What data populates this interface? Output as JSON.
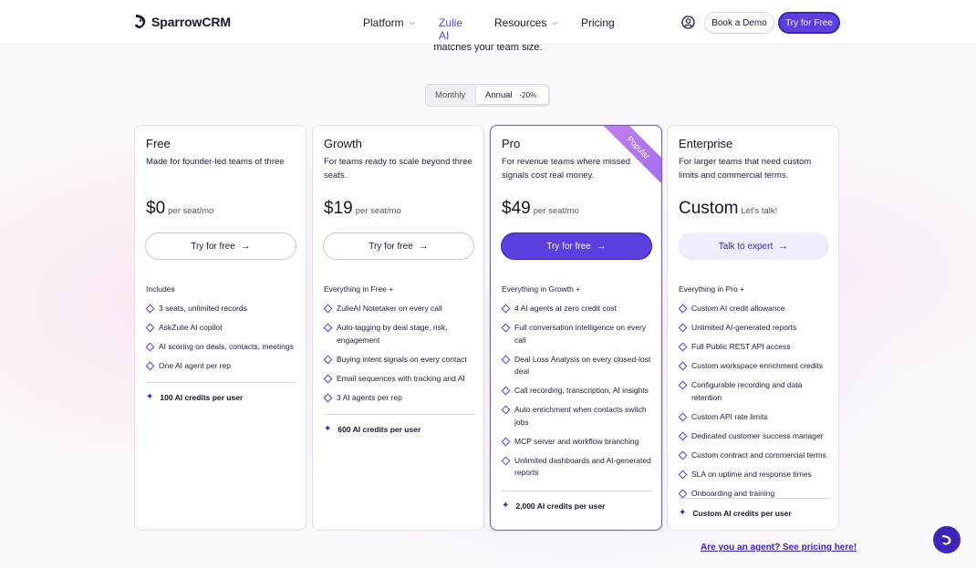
{
  "nav": {
    "logo": "SparrowCRM",
    "links": [
      "Platform",
      "Zulie AI",
      "Resources",
      "Pricing"
    ],
    "book_demo": "Book a Demo",
    "try_free": "Try for Free"
  },
  "hero": {
    "subtitle": "matches your team size."
  },
  "toggle": {
    "monthly": "Monthly",
    "annual": "Annual",
    "badge": "-20%"
  },
  "plans": [
    {
      "name": "Free",
      "desc": "Made for founder-led teams of three",
      "price": "$0",
      "unit": "per seat/mo",
      "cta": "Try for free",
      "includes": "Includes",
      "features": [
        "3 seats, unlimited records",
        "AskZulie AI copilot",
        "AI scoring on deals, contacts, meetings",
        "One AI agent per rep"
      ],
      "credits": "100 AI credits per user"
    },
    {
      "name": "Growth",
      "desc": "For teams ready to scale beyond three seats.",
      "price": "$19",
      "unit": "per seat/mo",
      "cta": "Try for free",
      "includes": "Everything in Free +",
      "features": [
        "ZulieAI Notetaker on every call",
        "Auto-tagging by deal stage, risk, engagement",
        "Buying intent signals on every contact",
        "Email sequences with tracking and AI",
        "3 AI agents per rep"
      ],
      "credits": "600 AI credits per user"
    },
    {
      "name": "Pro",
      "badge": "Popular",
      "desc": "For revenue teams where missed signals cost real money.",
      "price": "$49",
      "unit": "per seat/mo",
      "cta": "Try for free",
      "includes": "Everything in Growth +",
      "features": [
        "4 AI agents at zero credit cost",
        "Full conversation intelligence on every call",
        "Deal Loss Analysis on every closed-lost deal",
        "Call recording, transcription, AI insights",
        "Auto enrichment when contacts switch jobs",
        "MCP server and workflow branching",
        "Unlimited dashboards and AI-generated reports"
      ],
      "credits": "2,000 AI credits per user"
    },
    {
      "name": "Enterprise",
      "desc": "For larger teams that need custom limits and commercial terms.",
      "price": "Custom",
      "unit": "Let's talk!",
      "cta": "Talk to expert",
      "includes": "Everything in Pro +",
      "features": [
        "Custom AI credit allowance",
        "Unlimited AI-generated reports",
        "Full Public REST API access",
        "Custom workspace enrichment credits",
        "Configurable recording and data retention",
        "Custom API rate limits",
        "Dedicated customer success manager",
        "Custom contract and commercial terms",
        "SLA on uptime and response times",
        "Onboarding and training"
      ],
      "credits": "Custom AI credits per user"
    }
  ],
  "footer": {
    "agent_link": "Are you an agent? See pricing here!"
  },
  "colors": {
    "accent": "#5b3fe0",
    "accent_dark": "#3c25b8",
    "ribbon": "#b276f0"
  }
}
